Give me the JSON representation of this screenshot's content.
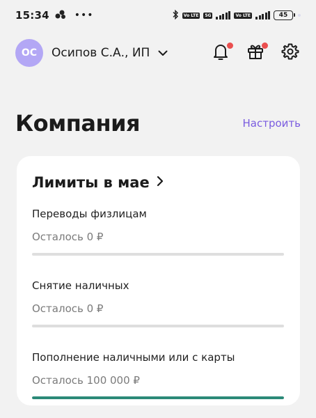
{
  "status_bar": {
    "time": "15:34",
    "dots": "•••",
    "network_tags": [
      "Vo LTE",
      "5G",
      "Vo LTE"
    ],
    "battery": "45"
  },
  "header": {
    "avatar_initials": "ОС",
    "account_name": "Осипов С.А., ИП",
    "notification_icon": "bell-icon",
    "gift_icon": "gift-icon",
    "settings_icon": "gear-icon"
  },
  "page": {
    "title": "Компания",
    "configure_label": "Настроить"
  },
  "limits_card": {
    "title": "Лимиты в мае",
    "items": [
      {
        "name": "Переводы физлицам",
        "remaining": "Осталось 0 ₽",
        "progress": 0
      },
      {
        "name": "Снятие наличных",
        "remaining": "Осталось 0 ₽",
        "progress": 0
      },
      {
        "name": "Пополнение наличными или с карты",
        "remaining": "Осталось 100 000 ₽",
        "progress": 1
      }
    ]
  },
  "colors": {
    "accent": "#7a5ce0",
    "avatar": "#b3a7f5",
    "progress_fill": "#2b8a78",
    "badge": "#ea4f4f"
  }
}
